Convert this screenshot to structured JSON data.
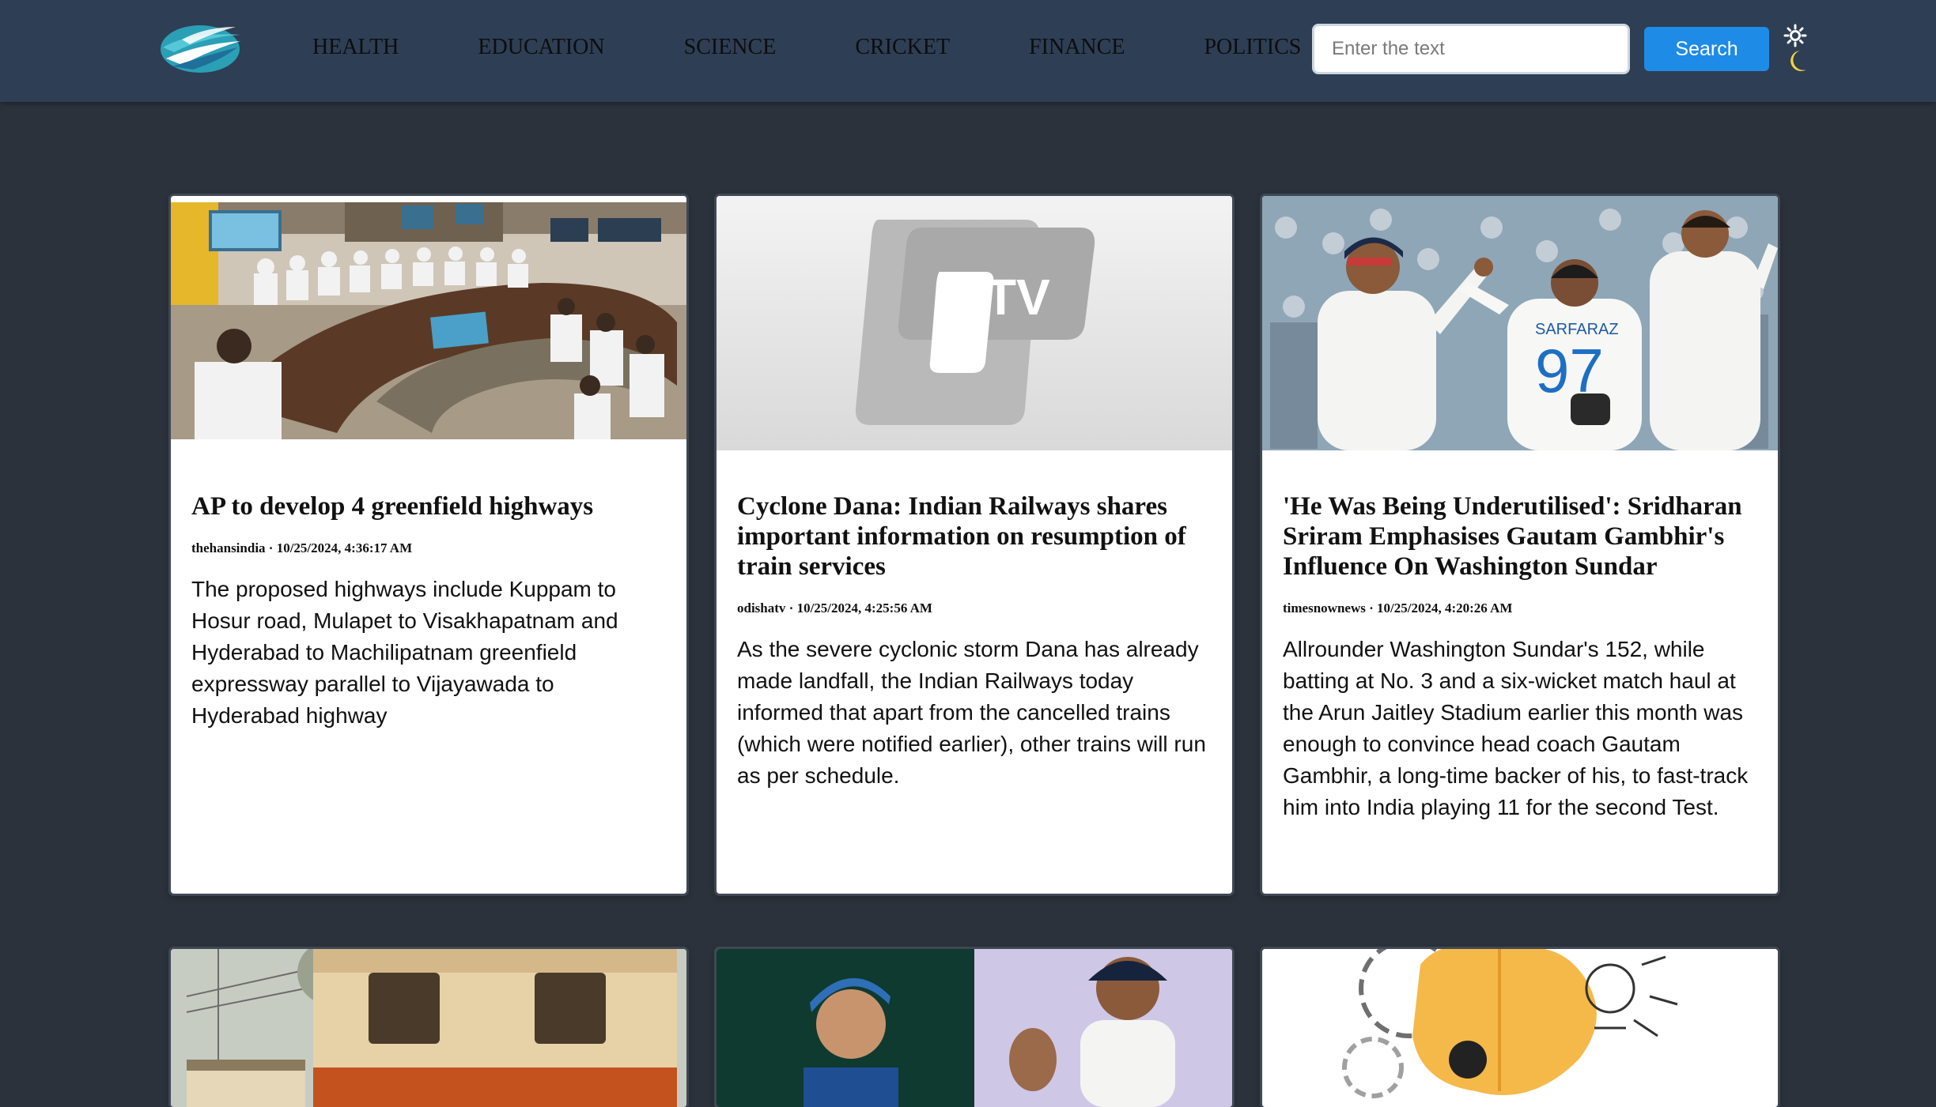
{
  "nav": {
    "links": [
      "HEALTH",
      "EDUCATION",
      "SCIENCE",
      "CRICKET",
      "FINANCE",
      "POLITICS"
    ],
    "search_placeholder": "Enter the text",
    "search_label": "Search",
    "theme_icons": [
      "sun-icon",
      "moon-icon"
    ]
  },
  "articles": [
    {
      "title": "AP to develop 4 greenfield highways",
      "source": "thehansindia",
      "timestamp": "10/25/2024, 4:36:17 AM",
      "meta": "thehansindia · 10/25/2024, 4:36:17 AM",
      "description": "The proposed highways include Kuppam to Hosur road, Mulapet to Visakhapatnam and Hyderabad to Machilipatnam greenfield expressway parallel to Vijayawada to Hyderabad highway"
    },
    {
      "title": "Cyclone Dana: Indian Railways shares important information on resumption of train services",
      "source": "odishatv",
      "timestamp": "10/25/2024, 4:25:56 AM",
      "meta": "odishatv · 10/25/2024, 4:25:56 AM",
      "description": "As the severe cyclonic storm Dana has already made landfall, the Indian Railways today informed that apart from the cancelled trains (which were notified earlier), other trains will run as per schedule.",
      "image_logo_text": "TV"
    },
    {
      "title": "'He Was Being Underutilised': Sridharan Sriram Emphasises Gautam Gambhir's Influence On Washington Sundar",
      "source": "timesnownews",
      "timestamp": "10/25/2024, 4:20:26 AM",
      "meta": "timesnownews · 10/25/2024, 4:20:26 AM",
      "description": "Allrounder Washington Sundar's 152, while batting at No. 3 and a six-wicket match haul at the Arun Jaitley Stadium earlier this month was enough to convince head coach Gautam Gambhir, a long-time backer of his, to fast-track him into India playing 11 for the second Test.",
      "image_jersey_name": "SARFARAZ",
      "image_jersey_number": "97"
    },
    {
      "title": "",
      "description": ""
    },
    {
      "title": "",
      "description": ""
    },
    {
      "title": "",
      "description": ""
    }
  ],
  "colors": {
    "page_bg": "#2c323b",
    "navbar_bg": "#2e3e55",
    "accent": "#1e8be6",
    "card_bg": "#ffffff",
    "moon": "#f6d33c"
  }
}
